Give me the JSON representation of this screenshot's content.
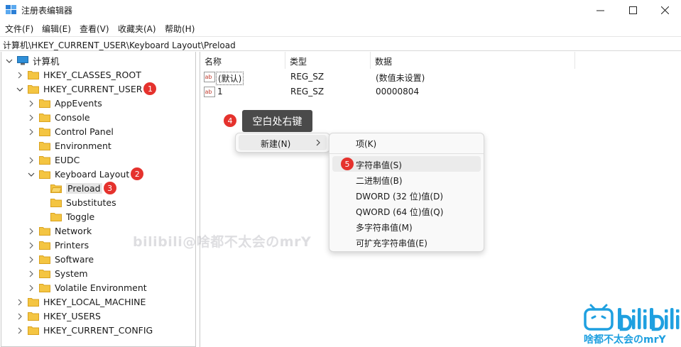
{
  "window": {
    "title": "注册表编辑器"
  },
  "menu": [
    "文件(F)",
    "编辑(E)",
    "查看(V)",
    "收藏夹(A)",
    "帮助(H)"
  ],
  "address": "计算机\\HKEY_CURRENT_USER\\Keyboard Layout\\Preload",
  "tree": {
    "root": "计算机",
    "items": [
      {
        "label": "HKEY_CLASSES_ROOT"
      },
      {
        "label": "HKEY_CURRENT_USER",
        "badge": "1"
      },
      {
        "label": "AppEvents"
      },
      {
        "label": "Console"
      },
      {
        "label": "Control Panel"
      },
      {
        "label": "Environment"
      },
      {
        "label": "EUDC"
      },
      {
        "label": "Keyboard Layout",
        "badge": "2"
      },
      {
        "label": "Preload",
        "badge": "3"
      },
      {
        "label": "Substitutes"
      },
      {
        "label": "Toggle"
      },
      {
        "label": "Network"
      },
      {
        "label": "Printers"
      },
      {
        "label": "Software"
      },
      {
        "label": "System"
      },
      {
        "label": "Volatile Environment"
      },
      {
        "label": "HKEY_LOCAL_MACHINE"
      },
      {
        "label": "HKEY_USERS"
      },
      {
        "label": "HKEY_CURRENT_CONFIG"
      }
    ]
  },
  "list": {
    "columns": [
      "名称",
      "类型",
      "数据"
    ],
    "rows": [
      {
        "name": "(默认)",
        "type": "REG_SZ",
        "data": "(数值未设置)"
      },
      {
        "name": "1",
        "type": "REG_SZ",
        "data": "00000804"
      }
    ]
  },
  "annotation": {
    "step4_badge": "4",
    "step4_text": "空白处右键",
    "step5_badge": "5"
  },
  "context_menu": {
    "new_label": "新建(N)",
    "submenu": [
      "项(K)",
      "字符串值(S)",
      "二进制值(B)",
      "DWORD (32 位)值(D)",
      "QWORD (64 位)值(Q)",
      "多字符串值(M)",
      "可扩充字符串值(E)"
    ]
  },
  "watermark": "bilibili@啥都不太会のmrY",
  "logo": {
    "caption": "啥都不太会のmrY"
  },
  "colors": {
    "badge": "#e5322d",
    "folder": "#f4c542",
    "tooltip_bg": "#4a4a4a",
    "bilibili_blue": "#1fa0e0"
  }
}
